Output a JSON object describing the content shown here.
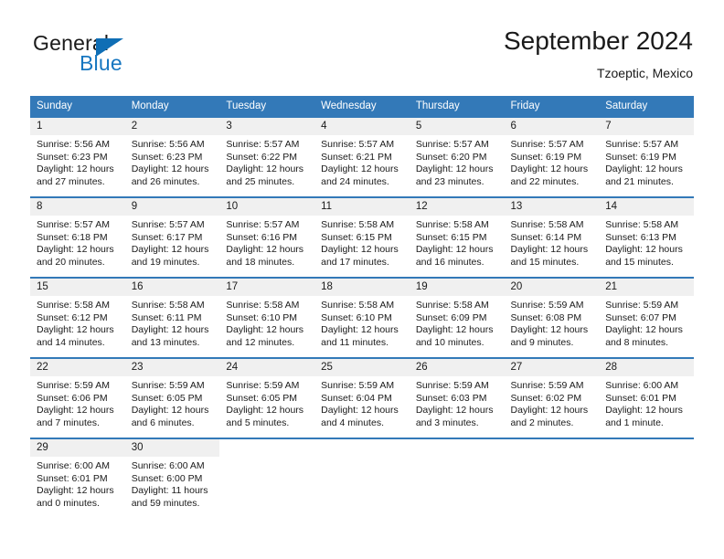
{
  "brand": {
    "name_primary": "General",
    "name_secondary": "Blue",
    "triangle_color": "#0f6eb5",
    "blue_text_color": "#1676c0"
  },
  "header": {
    "title": "September 2024",
    "subtitle": "Tzoeptic, Mexico"
  },
  "theme": {
    "header_row_bg": "#3379b8",
    "header_row_text": "#ffffff",
    "daynum_band_bg": "#f0f0f0",
    "week_separator": "#3379b8",
    "page_bg": "#ffffff",
    "body_text": "#1a1a1a"
  },
  "weekday_headers": [
    "Sunday",
    "Monday",
    "Tuesday",
    "Wednesday",
    "Thursday",
    "Friday",
    "Saturday"
  ],
  "weeks": [
    [
      {
        "day": "1",
        "sunrise": "Sunrise: 5:56 AM",
        "sunset": "Sunset: 6:23 PM",
        "daylight_line1": "Daylight: 12 hours",
        "daylight_line2": "and 27 minutes."
      },
      {
        "day": "2",
        "sunrise": "Sunrise: 5:56 AM",
        "sunset": "Sunset: 6:23 PM",
        "daylight_line1": "Daylight: 12 hours",
        "daylight_line2": "and 26 minutes."
      },
      {
        "day": "3",
        "sunrise": "Sunrise: 5:57 AM",
        "sunset": "Sunset: 6:22 PM",
        "daylight_line1": "Daylight: 12 hours",
        "daylight_line2": "and 25 minutes."
      },
      {
        "day": "4",
        "sunrise": "Sunrise: 5:57 AM",
        "sunset": "Sunset: 6:21 PM",
        "daylight_line1": "Daylight: 12 hours",
        "daylight_line2": "and 24 minutes."
      },
      {
        "day": "5",
        "sunrise": "Sunrise: 5:57 AM",
        "sunset": "Sunset: 6:20 PM",
        "daylight_line1": "Daylight: 12 hours",
        "daylight_line2": "and 23 minutes."
      },
      {
        "day": "6",
        "sunrise": "Sunrise: 5:57 AM",
        "sunset": "Sunset: 6:19 PM",
        "daylight_line1": "Daylight: 12 hours",
        "daylight_line2": "and 22 minutes."
      },
      {
        "day": "7",
        "sunrise": "Sunrise: 5:57 AM",
        "sunset": "Sunset: 6:19 PM",
        "daylight_line1": "Daylight: 12 hours",
        "daylight_line2": "and 21 minutes."
      }
    ],
    [
      {
        "day": "8",
        "sunrise": "Sunrise: 5:57 AM",
        "sunset": "Sunset: 6:18 PM",
        "daylight_line1": "Daylight: 12 hours",
        "daylight_line2": "and 20 minutes."
      },
      {
        "day": "9",
        "sunrise": "Sunrise: 5:57 AM",
        "sunset": "Sunset: 6:17 PM",
        "daylight_line1": "Daylight: 12 hours",
        "daylight_line2": "and 19 minutes."
      },
      {
        "day": "10",
        "sunrise": "Sunrise: 5:57 AM",
        "sunset": "Sunset: 6:16 PM",
        "daylight_line1": "Daylight: 12 hours",
        "daylight_line2": "and 18 minutes."
      },
      {
        "day": "11",
        "sunrise": "Sunrise: 5:58 AM",
        "sunset": "Sunset: 6:15 PM",
        "daylight_line1": "Daylight: 12 hours",
        "daylight_line2": "and 17 minutes."
      },
      {
        "day": "12",
        "sunrise": "Sunrise: 5:58 AM",
        "sunset": "Sunset: 6:15 PM",
        "daylight_line1": "Daylight: 12 hours",
        "daylight_line2": "and 16 minutes."
      },
      {
        "day": "13",
        "sunrise": "Sunrise: 5:58 AM",
        "sunset": "Sunset: 6:14 PM",
        "daylight_line1": "Daylight: 12 hours",
        "daylight_line2": "and 15 minutes."
      },
      {
        "day": "14",
        "sunrise": "Sunrise: 5:58 AM",
        "sunset": "Sunset: 6:13 PM",
        "daylight_line1": "Daylight: 12 hours",
        "daylight_line2": "and 15 minutes."
      }
    ],
    [
      {
        "day": "15",
        "sunrise": "Sunrise: 5:58 AM",
        "sunset": "Sunset: 6:12 PM",
        "daylight_line1": "Daylight: 12 hours",
        "daylight_line2": "and 14 minutes."
      },
      {
        "day": "16",
        "sunrise": "Sunrise: 5:58 AM",
        "sunset": "Sunset: 6:11 PM",
        "daylight_line1": "Daylight: 12 hours",
        "daylight_line2": "and 13 minutes."
      },
      {
        "day": "17",
        "sunrise": "Sunrise: 5:58 AM",
        "sunset": "Sunset: 6:10 PM",
        "daylight_line1": "Daylight: 12 hours",
        "daylight_line2": "and 12 minutes."
      },
      {
        "day": "18",
        "sunrise": "Sunrise: 5:58 AM",
        "sunset": "Sunset: 6:10 PM",
        "daylight_line1": "Daylight: 12 hours",
        "daylight_line2": "and 11 minutes."
      },
      {
        "day": "19",
        "sunrise": "Sunrise: 5:58 AM",
        "sunset": "Sunset: 6:09 PM",
        "daylight_line1": "Daylight: 12 hours",
        "daylight_line2": "and 10 minutes."
      },
      {
        "day": "20",
        "sunrise": "Sunrise: 5:59 AM",
        "sunset": "Sunset: 6:08 PM",
        "daylight_line1": "Daylight: 12 hours",
        "daylight_line2": "and 9 minutes."
      },
      {
        "day": "21",
        "sunrise": "Sunrise: 5:59 AM",
        "sunset": "Sunset: 6:07 PM",
        "daylight_line1": "Daylight: 12 hours",
        "daylight_line2": "and 8 minutes."
      }
    ],
    [
      {
        "day": "22",
        "sunrise": "Sunrise: 5:59 AM",
        "sunset": "Sunset: 6:06 PM",
        "daylight_line1": "Daylight: 12 hours",
        "daylight_line2": "and 7 minutes."
      },
      {
        "day": "23",
        "sunrise": "Sunrise: 5:59 AM",
        "sunset": "Sunset: 6:05 PM",
        "daylight_line1": "Daylight: 12 hours",
        "daylight_line2": "and 6 minutes."
      },
      {
        "day": "24",
        "sunrise": "Sunrise: 5:59 AM",
        "sunset": "Sunset: 6:05 PM",
        "daylight_line1": "Daylight: 12 hours",
        "daylight_line2": "and 5 minutes."
      },
      {
        "day": "25",
        "sunrise": "Sunrise: 5:59 AM",
        "sunset": "Sunset: 6:04 PM",
        "daylight_line1": "Daylight: 12 hours",
        "daylight_line2": "and 4 minutes."
      },
      {
        "day": "26",
        "sunrise": "Sunrise: 5:59 AM",
        "sunset": "Sunset: 6:03 PM",
        "daylight_line1": "Daylight: 12 hours",
        "daylight_line2": "and 3 minutes."
      },
      {
        "day": "27",
        "sunrise": "Sunrise: 5:59 AM",
        "sunset": "Sunset: 6:02 PM",
        "daylight_line1": "Daylight: 12 hours",
        "daylight_line2": "and 2 minutes."
      },
      {
        "day": "28",
        "sunrise": "Sunrise: 6:00 AM",
        "sunset": "Sunset: 6:01 PM",
        "daylight_line1": "Daylight: 12 hours",
        "daylight_line2": "and 1 minute."
      }
    ],
    [
      {
        "day": "29",
        "sunrise": "Sunrise: 6:00 AM",
        "sunset": "Sunset: 6:01 PM",
        "daylight_line1": "Daylight: 12 hours",
        "daylight_line2": "and 0 minutes."
      },
      {
        "day": "30",
        "sunrise": "Sunrise: 6:00 AM",
        "sunset": "Sunset: 6:00 PM",
        "daylight_line1": "Daylight: 11 hours",
        "daylight_line2": "and 59 minutes."
      },
      {
        "day": "",
        "sunrise": "",
        "sunset": "",
        "daylight_line1": "",
        "daylight_line2": ""
      },
      {
        "day": "",
        "sunrise": "",
        "sunset": "",
        "daylight_line1": "",
        "daylight_line2": ""
      },
      {
        "day": "",
        "sunrise": "",
        "sunset": "",
        "daylight_line1": "",
        "daylight_line2": ""
      },
      {
        "day": "",
        "sunrise": "",
        "sunset": "",
        "daylight_line1": "",
        "daylight_line2": ""
      },
      {
        "day": "",
        "sunrise": "",
        "sunset": "",
        "daylight_line1": "",
        "daylight_line2": ""
      }
    ]
  ]
}
